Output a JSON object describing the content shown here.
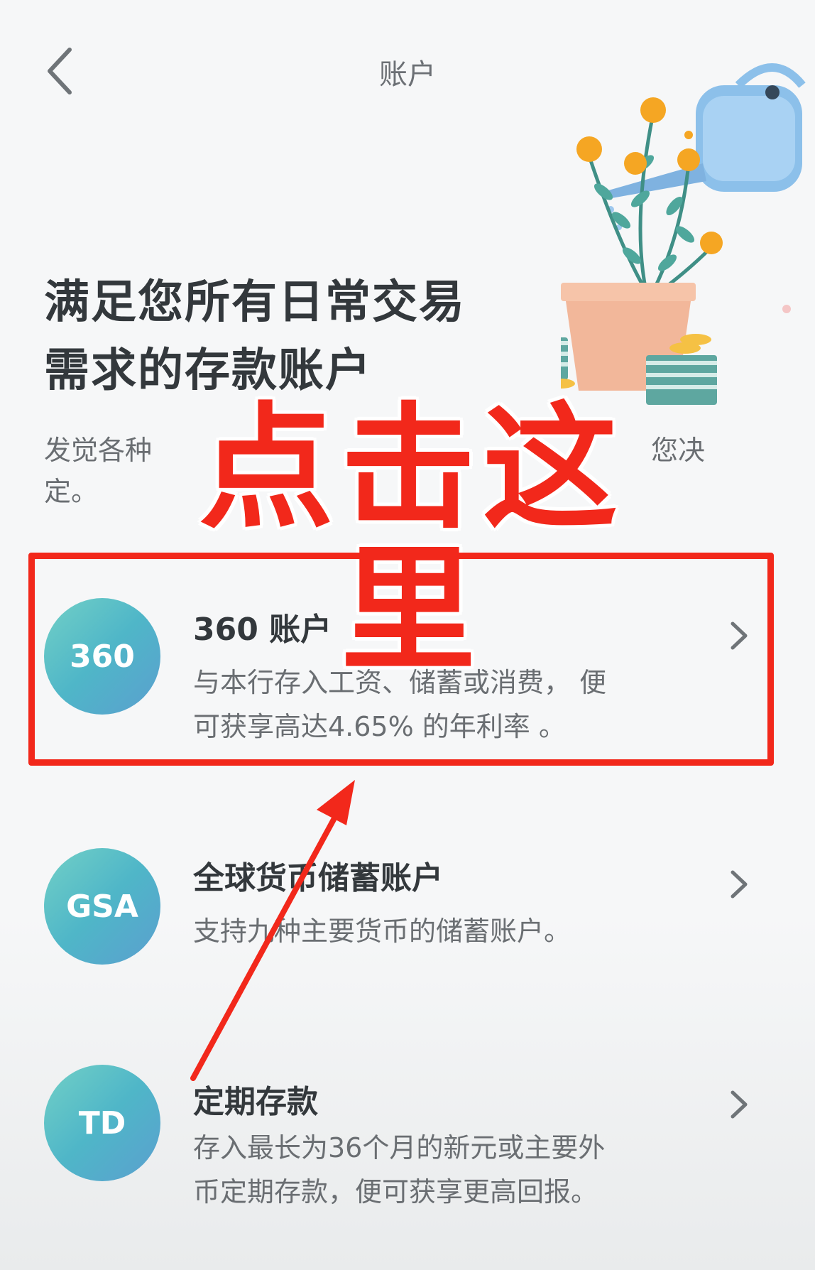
{
  "header": {
    "title": "账户"
  },
  "hero": {
    "headline_line1": "满足您所有日常交易",
    "headline_line2": "需求的存款账户",
    "subtext_line1": "发觉各种",
    "subtext_line1_end": "您决",
    "subtext_line2": "定。"
  },
  "overlay": {
    "text": "点击这里"
  },
  "accounts": [
    {
      "badge": "360",
      "title": "360 账户",
      "desc_line1": "与本行存入工资、储蓄或消费， 便",
      "desc_line2": "可获享高达4.65% 的年利率 。"
    },
    {
      "badge": "GSA",
      "title": "全球货币储蓄账户",
      "desc_line1": "支持九种主要货币的储蓄账户。",
      "desc_line2": ""
    },
    {
      "badge": "TD",
      "title": "定期存款",
      "desc_line1": "存入最长为36个月的新元或主要外",
      "desc_line2": "币定期存款，便可获享更高回报。"
    }
  ],
  "colors": {
    "accent_red": "#f2281b",
    "badge_gradient_start": "#72d0c6",
    "badge_gradient_end": "#5b9fcf",
    "text_dark": "#33383c",
    "text_muted": "#6a6e72"
  },
  "icons": {
    "back": "chevron-left-icon",
    "row_chevron": "chevron-right-icon"
  }
}
